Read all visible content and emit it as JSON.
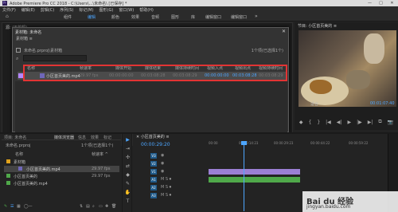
{
  "window": {
    "title": "Adobe Premiere Pro CC 2018 - C:\\Users\\...\\未命名\\ [已保存] *",
    "controls": [
      "—",
      "□",
      "✕"
    ]
  },
  "menu": [
    "文件(F)",
    "编辑(E)",
    "剪辑(C)",
    "序列(S)",
    "标记(M)",
    "图形(G)",
    "窗口(W)",
    "帮助(H)"
  ],
  "workspaces": {
    "tabs": [
      "组件",
      "编辑",
      "颜色",
      "效果",
      "音频",
      "图形",
      "库",
      "编辑窗口",
      "编辑窗口"
    ],
    "active_index": 1,
    "more": "»"
  },
  "source_monitor": {
    "label": "源: (无剪辑)"
  },
  "program_monitor": {
    "label": "节目: 小区首页美的 ≡",
    "fit": "适合",
    "time": "00:01:07:40",
    "controls": [
      "◆",
      "{",
      "}",
      "|◀",
      "◀|",
      "▶",
      "|▶",
      "▶|",
      "⧉",
      "📷"
    ]
  },
  "dialog": {
    "title": "素材箱: 未命名",
    "close": "✕",
    "panel_name": "素材箱 ≡",
    "path": "未命名.prproj\\素材箱",
    "item_count": "1个项(已选择1个)",
    "search_placeholder": "",
    "columns": [
      "名称",
      "帧速率",
      "媒体开始",
      "媒体结束",
      "媒体持续时间",
      "视频入点",
      "视频出点",
      "视频持续时间"
    ],
    "file": {
      "name": "小区首页美的.mp4",
      "fps": "29.97 fps",
      "start": "00:00:00:00",
      "end": "00:03:08:28",
      "duration": "00:03:08:29",
      "in": "00:00:00:00",
      "out": "00:03:08:28",
      "vduration": "00:03:08:29"
    },
    "footer": [
      "✎",
      "☰",
      "▦",
      "◯—",
      "⇅",
      "▤",
      "⌕",
      "▭",
      "✚",
      "🗑"
    ]
  },
  "project_panel": {
    "tabs": [
      "项目: 未命名",
      "媒体浏览器",
      "信息",
      "效果",
      "标记",
      "历史记录"
    ],
    "active_tab": 0,
    "project_name": "未命名.prproj",
    "count": "1个项(已选择1个)",
    "header": [
      "名称",
      "帧速率 ^"
    ],
    "rows": [
      {
        "name": "素材箱",
        "fps": "",
        "color": "#e0a21b"
      },
      {
        "name": "小区首页美的.mp4",
        "fps": "29.97 fps",
        "color": "#6f67b9"
      },
      {
        "name": "小区首页美的",
        "fps": "29.97 fps",
        "color": "#4fa84a"
      },
      {
        "name": "小区首页美的.mp4",
        "fps": "",
        "color": "#4fa84a"
      }
    ],
    "footer": [
      "✎",
      "☰",
      "▦",
      "◯—",
      "⇅",
      "▤",
      "⌕",
      "▭",
      "✚",
      "🗑"
    ]
  },
  "tools": [
    "▶",
    "⇥",
    "✣",
    "⇄",
    "◆",
    "✎",
    "✋",
    "T"
  ],
  "timeline": {
    "tab": "✕  小区首页美的 ≡",
    "timecode": "00:00:29:20",
    "ruler": [
      "00:00",
      "00:00:14:23",
      "00:00:29:23",
      "00:00:44:22",
      "00:00:59:22"
    ],
    "tracks": [
      {
        "name": "V3",
        "kind": "video",
        "clip": false
      },
      {
        "name": "V2",
        "kind": "video",
        "clip": false
      },
      {
        "name": "V1",
        "kind": "video",
        "clip": true
      },
      {
        "name": "A1",
        "kind": "audio",
        "clip": true
      },
      {
        "name": "A2",
        "kind": "audio",
        "clip": false
      },
      {
        "name": "A3",
        "kind": "audio",
        "clip": false
      }
    ],
    "clip_color": "#9b7fd4",
    "audio_clip_color": "#4fa84a"
  },
  "watermark": {
    "text": "Bai du 经验",
    "url": "jingyan.baidu.com"
  },
  "colors": {
    "accent": "#4da6ff",
    "highlight": "#e23434",
    "purple": "#b486ff"
  }
}
